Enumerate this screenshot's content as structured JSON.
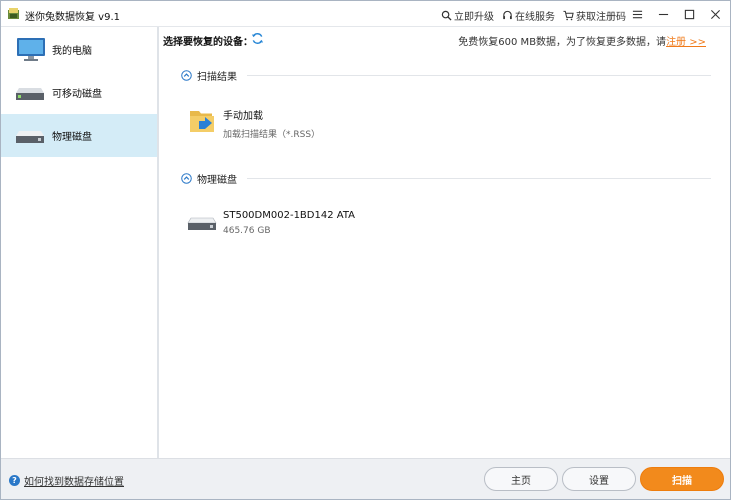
{
  "app": {
    "title": "迷你兔数据恢复 v9.1"
  },
  "titlebar": {
    "actions": [
      {
        "label": "立即升级",
        "icon": "search-icon"
      },
      {
        "label": "在线服务",
        "icon": "headset-icon"
      },
      {
        "label": "获取注册码",
        "icon": "cart-icon"
      }
    ]
  },
  "sidebar": {
    "items": [
      {
        "label": "我的电脑",
        "icon": "monitor-icon",
        "active": false
      },
      {
        "label": "可移动磁盘",
        "icon": "removable-disk-icon",
        "active": false
      },
      {
        "label": "物理磁盘",
        "icon": "physical-disk-icon",
        "active": true
      }
    ]
  },
  "header": {
    "select_label": "选择要恢复的设备：",
    "promo_text": "免费恢复600 MB数据，为了恢复更多数据，请",
    "promo_link": "注册 >>"
  },
  "sections": {
    "scan_results": {
      "title": "扫描结果",
      "entry": {
        "name": "手动加载",
        "sub": "加载扫描结果（*.RSS）"
      }
    },
    "physical_disks": {
      "title": "物理磁盘",
      "entry": {
        "name": "ST500DM002-1BD142 ATA",
        "sub": "465.76 GB"
      }
    }
  },
  "footer": {
    "help": "如何找到数据存储位置",
    "home_button": "主页",
    "settings_button": "设置",
    "scan_button": "扫描"
  },
  "colors": {
    "accent": "#f28a1c",
    "active_bg": "#d4ecf7",
    "link": "#f07a1a"
  }
}
